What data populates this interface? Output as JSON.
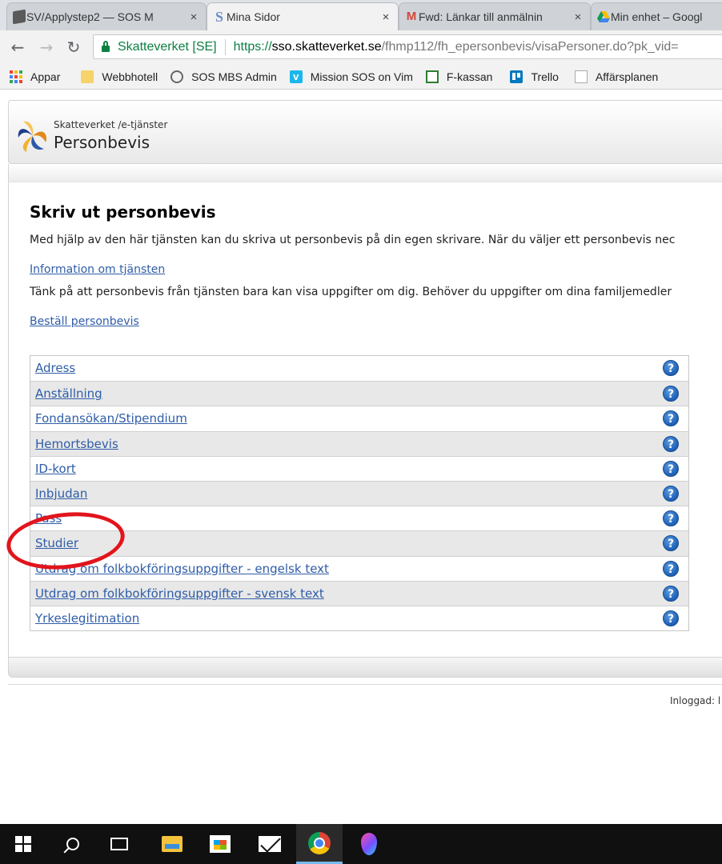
{
  "browser": {
    "tabs": [
      {
        "title": "SV/Applystep2 — SOS M",
        "icon": "cube-icon"
      },
      {
        "title": "Mina Sidor",
        "icon": "s-logo-icon"
      },
      {
        "title": "Fwd: Länkar till anmälnin",
        "icon": "gmail-icon"
      },
      {
        "title": "Min enhet – Googl",
        "icon": "drive-icon"
      }
    ],
    "close_glyph": "×",
    "secure_label": "Skatteverket [SE]",
    "url": {
      "scheme": "https://",
      "host": "sso.skatteverket.se",
      "path": "/fhmp112/fh_epersonbevis/visaPersoner.do?pk_vid="
    },
    "bookmarks": [
      {
        "label": "Appar",
        "icon": "apps-grid-icon"
      },
      {
        "label": "Webbhotell",
        "icon": "folder-icon"
      },
      {
        "label": "SOS MBS Admin",
        "icon": "swirl-icon"
      },
      {
        "label": "Mission SOS on Vim",
        "icon": "vimeo-icon"
      },
      {
        "label": "F-kassan",
        "icon": "flag-icon"
      },
      {
        "label": "Trello",
        "icon": "trello-icon"
      },
      {
        "label": "Affärsplanen",
        "icon": "document-icon"
      }
    ]
  },
  "site": {
    "subtitle": "Skatteverket /e-tjänster",
    "title": "Personbevis"
  },
  "main": {
    "title": "Skriv ut personbevis",
    "intro": "Med hjälp av den här tjänsten kan du skriva ut personbevis på din egen skrivare. När du väljer ett personbevis nec",
    "info_link": "Information om tjänsten",
    "note": "Tänk på att personbevis från tjänsten bara kan visa uppgifter om dig. Behöver du uppgifter om dina familjemedler",
    "order_link": "Beställ personbevis",
    "help_glyph": "?",
    "certificates": [
      "Adress",
      "Anställning",
      "Fondansökan/Stipendium",
      "Hemortsbevis",
      "ID-kort",
      "Inbjudan",
      "Pass",
      "Studier",
      "Utdrag om folkbokföringsuppgifter - engelsk text",
      "Utdrag om folkbokföringsuppgifter - svensk text",
      "Yrkeslegitimation"
    ]
  },
  "footer": {
    "logged_in": "Inloggad: l"
  },
  "colors": {
    "link": "#2f5da8",
    "secure": "#0b8043",
    "annotation": "#e2141c",
    "alt_row": "#e8e8e8"
  }
}
